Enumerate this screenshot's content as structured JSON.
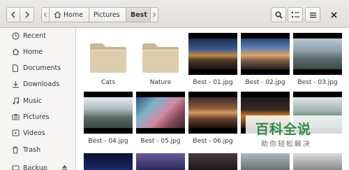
{
  "path": {
    "home": "Home",
    "pictures": "Pictures",
    "current": "Best"
  },
  "sidebar": {
    "items": [
      {
        "label": "Recent",
        "icon": "clock-icon"
      },
      {
        "label": "Home",
        "icon": "home-icon"
      },
      {
        "label": "Documents",
        "icon": "document-icon"
      },
      {
        "label": "Downloads",
        "icon": "download-icon"
      },
      {
        "label": "Music",
        "icon": "music-icon"
      },
      {
        "label": "Pictures",
        "icon": "camera-icon"
      },
      {
        "label": "Videos",
        "icon": "video-icon"
      },
      {
        "label": "Trash",
        "icon": "trash-icon"
      },
      {
        "label": "Backup",
        "icon": "backup-icon"
      }
    ]
  },
  "files": [
    {
      "name": "Cats",
      "kind": "folder"
    },
    {
      "name": "Nature",
      "kind": "folder"
    },
    {
      "name": "Best - 01.jpg",
      "kind": "image"
    },
    {
      "name": "Best - 02.jpg",
      "kind": "image"
    },
    {
      "name": "Best - 03.jpg",
      "kind": "image"
    },
    {
      "name": "Best - 04.jpg",
      "kind": "image"
    },
    {
      "name": "Best - 05.jpg",
      "kind": "image"
    },
    {
      "name": "Best - 06.jpg",
      "kind": "image"
    },
    {
      "name": "",
      "kind": "image"
    },
    {
      "name": "",
      "kind": "image"
    }
  ],
  "watermark": {
    "title": "百科全说",
    "subtitle": "助你轻松解决"
  },
  "colors": {
    "folder": "#d8c8a8",
    "accent_green": "#2f8a4a"
  }
}
